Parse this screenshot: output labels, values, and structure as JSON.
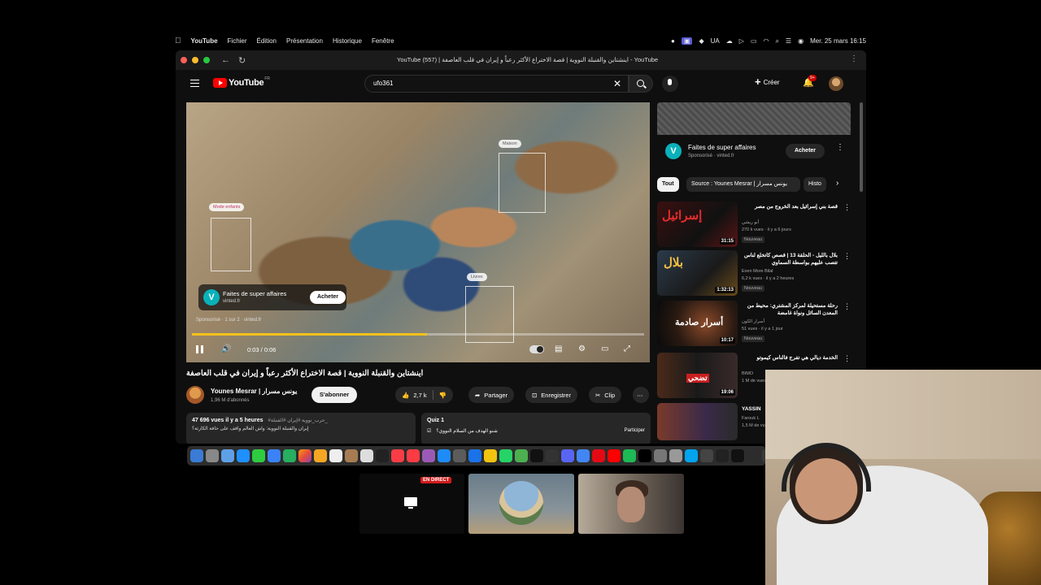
{
  "menubar": {
    "app": "YouTube",
    "items": [
      "Fichier",
      "Édition",
      "Présentation",
      "Historique",
      "Fenêtre"
    ],
    "lang": "UA",
    "datetime": "Mer. 25 mars  16:15"
  },
  "browser": {
    "tab_title": "YouTube (557) | اينشتاين والقنبلة النووية | قصة الاختراع الأكثر رعباً و إيران في قلب العاصفة - YouTube"
  },
  "yt": {
    "logo": "YouTube",
    "region": "FR",
    "search_value": "ufo361",
    "create_label": "Créer",
    "notif_count": "9+"
  },
  "player": {
    "tags": [
      "Mode enfants",
      "Maison",
      "Livres"
    ],
    "ad_title": "Faites de super affaires",
    "ad_domain": "vinted.fr",
    "ad_button": "Acheter",
    "sponsor_line": "Sponsorisé · 1 sur 2 · vinted.fr",
    "time": "0:03 / 0:06",
    "progress": 0.52
  },
  "video": {
    "title": "اينشتاين والقنبلة النووية | قصة الاختراع الأكثر رعباً و إيران في قلب العاصفة",
    "channel": "Younes Mesrar | يونس مسرار",
    "subs": "1,96 M d'abonnés",
    "subscribe": "S'abonner",
    "likes": "2,7 k",
    "share": "Partager",
    "save": "Enregistrer",
    "clip": "Clip",
    "views": "47 696 vues  il y a 5 heures",
    "hashtags": "#حرب_نووية #إيران #القنبلة_",
    "desc_line": "إيران والقنبلة النووية: واش العالم واقف على حافة الكارثة؟",
    "quiz": "Quiz 1",
    "quiz_q": "شنو الهدف من السلام النووي؟",
    "quiz_btn": "Participer"
  },
  "sidebar": {
    "ad_title": "Faites de super affaires",
    "ad_sub": "Sponsorisé · vinted.fr",
    "ad_button": "Acheter",
    "chips": [
      "Tout",
      "Source : Younes Mesrar | يونس مسرار",
      "Histo"
    ],
    "recs": [
      {
        "title": "قصة بني إسرائيل بعد الخروج من مصر",
        "channel": "أبو ريشي",
        "meta": "270 k vues · il y a 6 jours",
        "duration": "31:15",
        "badge": "Nouveau"
      },
      {
        "title": "بلال بالليل - الحلقة 13 | قصص كاتخلع لناس تتصب عليهم بواسطة السماوي",
        "channel": "Even More Bilal",
        "meta": "6,2 k vues · il y a 2 heures",
        "duration": "1:32:13",
        "badge": "Nouveau"
      },
      {
        "title": "رحلة مستحيلة لمركز المشتري: محيط من المعدن السائل ونواة غامضة",
        "channel": "أسرار الكون",
        "meta": "51 vues · il y a 1 jour",
        "duration": "10:17",
        "badge": "Nouveau"
      },
      {
        "title": "الخدمة ديالي هي تفرج فالناس كيموتو",
        "channel": "BIMO",
        "meta": "1 M de vues",
        "duration": "19:06",
        "badge": ""
      },
      {
        "title": "YASSIN",
        "channel": "Farouk L",
        "meta": "1,5 M de vues",
        "duration": "",
        "badge": ""
      }
    ],
    "thumb_texts": [
      "إسرائيل",
      "بلال",
      "أسرار صادمة",
      "تضحي"
    ]
  },
  "meeting": {
    "live_label": "EN DIRECT"
  },
  "colors": {
    "yt_red": "#ff0000",
    "progress": "#f6c21a",
    "vinted": "#09b1ba"
  }
}
